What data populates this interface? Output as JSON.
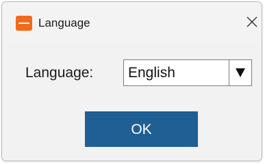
{
  "window": {
    "title": "Language",
    "app_icon": "app-logo-icon",
    "close_icon": "close-icon",
    "close_glyph": "×"
  },
  "form": {
    "language_label": "Language:",
    "language_value": "English",
    "dropdown_icon": "triangle-down-icon"
  },
  "actions": {
    "ok_label": "OK"
  },
  "colors": {
    "app_icon": "#f26b1d",
    "ok_button_bg": "#1f5f93",
    "ok_button_text": "#ffffff"
  }
}
